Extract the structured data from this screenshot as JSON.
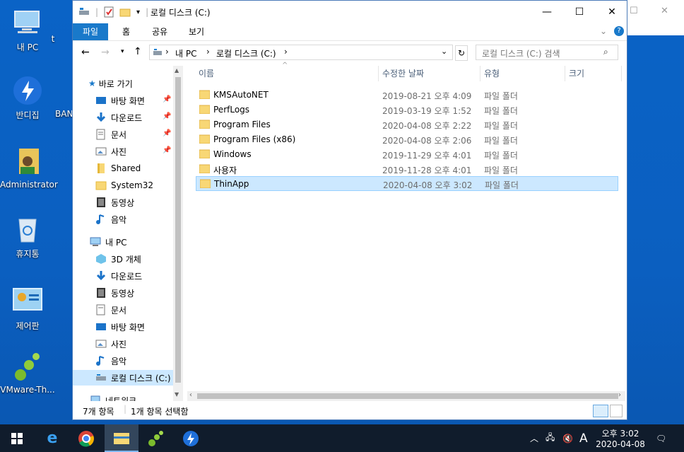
{
  "desktop": {
    "icons": [
      {
        "label": "내 PC"
      },
      {
        "label": "반디집"
      },
      {
        "label": "Administrator"
      },
      {
        "label": "휴지통"
      },
      {
        "label": "제어판"
      },
      {
        "label": "VMware-Th..."
      }
    ],
    "partial": [
      "t",
      "BAN"
    ]
  },
  "window": {
    "title": "로컬 디스크 (C:)",
    "ribbon_tabs": [
      "파일",
      "홈",
      "공유",
      "보기"
    ],
    "address": {
      "segments": [
        "내 PC",
        "로컬 디스크 (C:)"
      ]
    },
    "search_placeholder": "로컬 디스크 (C:) 검색",
    "nav": {
      "quick_access": "바로 가기",
      "items": [
        {
          "label": "바탕 화면",
          "pinned": true,
          "icon": "desktop-icon"
        },
        {
          "label": "다운로드",
          "pinned": true,
          "icon": "download-icon"
        },
        {
          "label": "문서",
          "pinned": true,
          "icon": "document-icon"
        },
        {
          "label": "사진",
          "pinned": true,
          "icon": "picture-icon"
        },
        {
          "label": "Shared",
          "icon": "folder-icon"
        },
        {
          "label": "System32",
          "icon": "folder-icon"
        },
        {
          "label": "동영상",
          "icon": "video-icon"
        },
        {
          "label": "음악",
          "icon": "music-icon"
        }
      ],
      "this_pc": "내 PC",
      "pc_items": [
        {
          "label": "3D 개체",
          "icon": "cube-icon"
        },
        {
          "label": "다운로드",
          "icon": "download-icon"
        },
        {
          "label": "동영상",
          "icon": "video-icon"
        },
        {
          "label": "문서",
          "icon": "document-icon"
        },
        {
          "label": "바탕 화면",
          "icon": "desktop-icon"
        },
        {
          "label": "사진",
          "icon": "picture-icon"
        },
        {
          "label": "음악",
          "icon": "music-icon"
        },
        {
          "label": "로컬 디스크 (C:)",
          "icon": "drive-icon",
          "selected": true
        }
      ],
      "network": "네트워크"
    },
    "columns": [
      "이름",
      "수정한 날짜",
      "유형",
      "크기"
    ],
    "files": [
      {
        "name": "KMSAutoNET",
        "date": "2019-08-21 오후 4:09",
        "type": "파일 폴더"
      },
      {
        "name": "PerfLogs",
        "date": "2019-03-19 오후 1:52",
        "type": "파일 폴더"
      },
      {
        "name": "Program Files",
        "date": "2020-04-08 오후 2:22",
        "type": "파일 폴더"
      },
      {
        "name": "Program Files (x86)",
        "date": "2020-04-08 오후 2:06",
        "type": "파일 폴더"
      },
      {
        "name": "Windows",
        "date": "2019-11-29 오후 4:01",
        "type": "파일 폴더"
      },
      {
        "name": "사용자",
        "date": "2019-11-28 오후 4:01",
        "type": "파일 폴더"
      },
      {
        "name": "ThinApp",
        "date": "2020-04-08 오후 3:02",
        "type": "파일 폴더",
        "selected": true
      }
    ],
    "status": {
      "count": "7개 항목",
      "selected": "1개 항목 선택함"
    }
  },
  "taskbar": {
    "time": "오후 3:02",
    "date": "2020-04-08",
    "ime": "A"
  },
  "colors": {
    "accent": "#1979ca",
    "select": "#cce8ff",
    "desktop": "#0b5fc0",
    "taskbar": "#101c2c"
  }
}
